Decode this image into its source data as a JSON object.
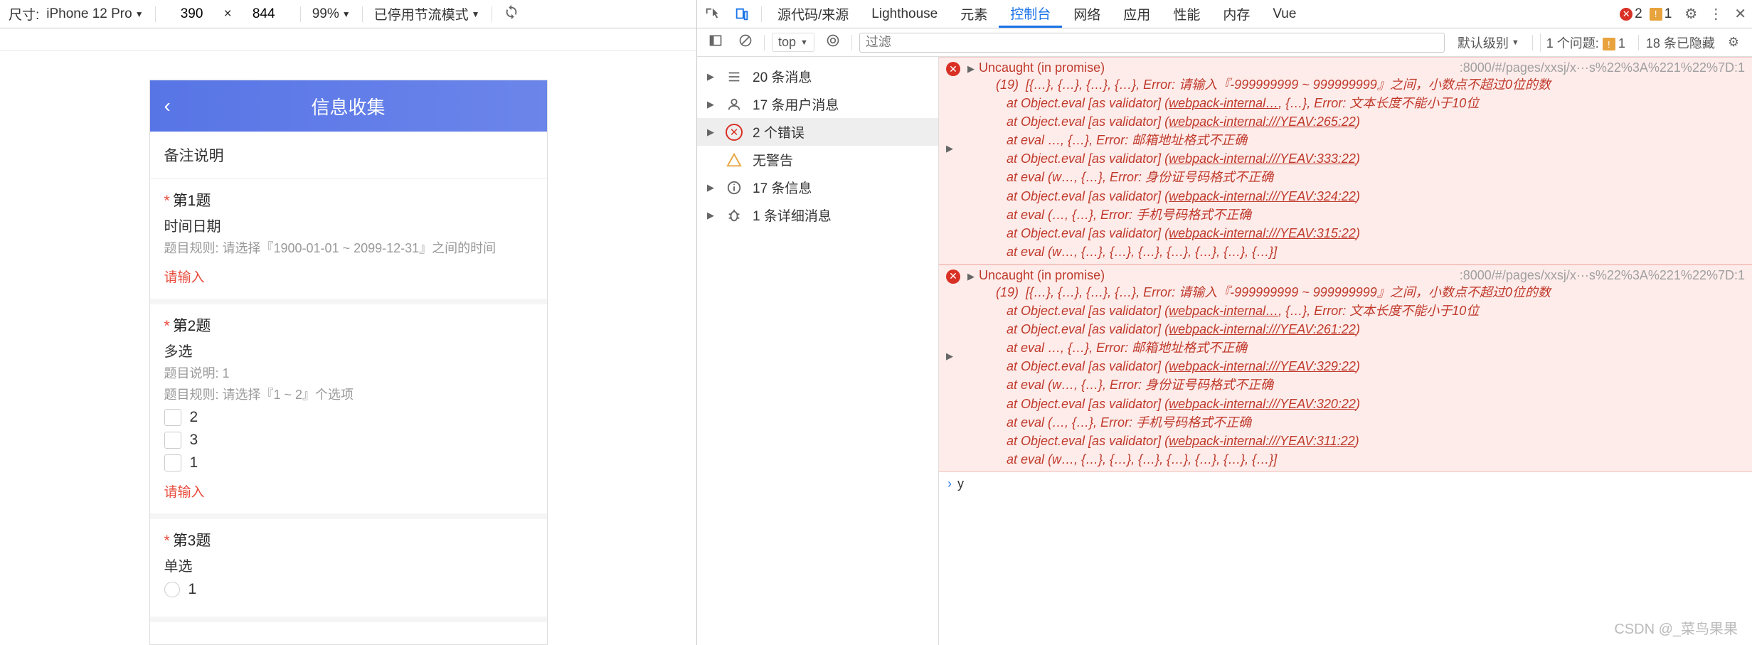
{
  "device_bar": {
    "size_label": "尺寸:",
    "device": "iPhone 12 Pro",
    "width": "390",
    "height": "844",
    "times": "×",
    "zoom": "99%",
    "throttle": "已停用节流模式"
  },
  "phone": {
    "title": "信息收集",
    "remark": "备注说明",
    "q1": {
      "title": "第1题",
      "sub": "时间日期",
      "rule": "题目规则:  请选择『1900-01-01 ~ 2099-12-31』之间的时间",
      "placeholder": "请输入"
    },
    "q2": {
      "title": "第2题",
      "sub": "多选",
      "desc": "题目说明:  1",
      "rule": "题目规则:  请选择『1 ~ 2』个选项",
      "opts": [
        "2",
        "3",
        "1"
      ],
      "placeholder": "请输入"
    },
    "q3": {
      "title": "第3题",
      "sub": "单选",
      "opts": [
        "1"
      ]
    }
  },
  "tabs": {
    "sources": "源代码/来源",
    "lighthouse": "Lighthouse",
    "elements": "元素",
    "console": "控制台",
    "network": "网络",
    "application": "应用",
    "performance": "性能",
    "memory": "内存",
    "vue": "Vue",
    "err_count": "2",
    "warn_count": "1"
  },
  "con_bar": {
    "context": "top",
    "filter_ph": "过滤",
    "level": "默认级别",
    "issues_label": "1 个问题:",
    "issues_count": "1",
    "hidden": "18 条已隐藏"
  },
  "sidebar": {
    "messages": "20 条消息",
    "user": "17 条用户消息",
    "errors": "2 个错误",
    "warnings": "无警告",
    "info": "17 条信息",
    "verbose": "1 条详细消息"
  },
  "errors": [
    {
      "head": "Uncaught (in promise)",
      "src": ":8000/#/pages/xxsj/x···s%22%3A%221%22%7D:1",
      "lines": [
        "(19)  [{…}, {…}, {…}, {…}, Error: 请输入『-999999999 ~ 999999999』之间，小数点不超过0位的数",
        "   at Object.eval [as validator] (webpack-internal…, {…}, Error: 文本长度不能小于10位",
        "   at Object.eval [as validator] (webpack-internal:///YEAV:265:22)",
        "   at eval …, {…}, Error: 邮箱地址格式不正确",
        "   at Object.eval [as validator] (webpack-internal:///YEAV:333:22)",
        "   at eval (w…, {…}, Error: 身份证号码格式不正确",
        "   at Object.eval [as validator] (webpack-internal:///YEAV:324:22)",
        "   at eval (…, {…}, Error: 手机号码格式不正确",
        "   at Object.eval [as validator] (webpack-internal:///YEAV:315:22)",
        "   at eval (w…, {…}, {…}, {…}, {…}, {…}, {…}, {…}]"
      ]
    },
    {
      "head": "Uncaught (in promise)",
      "src": ":8000/#/pages/xxsj/x···s%22%3A%221%22%7D:1",
      "lines": [
        "(19)  [{…}, {…}, {…}, {…}, Error: 请输入『-999999999 ~ 999999999』之间，小数点不超过0位的数",
        "   at Object.eval [as validator] (webpack-internal…, {…}, Error: 文本长度不能小于10位",
        "   at Object.eval [as validator] (webpack-internal:///YEAV:261:22)",
        "   at eval …, {…}, Error: 邮箱地址格式不正确",
        "   at Object.eval [as validator] (webpack-internal:///YEAV:329:22)",
        "   at eval (w…, {…}, Error: 身份证号码格式不正确",
        "   at Object.eval [as validator] (webpack-internal:///YEAV:320:22)",
        "   at eval (…, {…}, Error: 手机号码格式不正确",
        "   at Object.eval [as validator] (webpack-internal:///YEAV:311:22)",
        "   at eval (w…, {…}, {…}, {…}, {…}, {…}, {…}, {…}]"
      ]
    }
  ],
  "prompt": "y",
  "watermark": "CSDN @_菜鸟果果"
}
